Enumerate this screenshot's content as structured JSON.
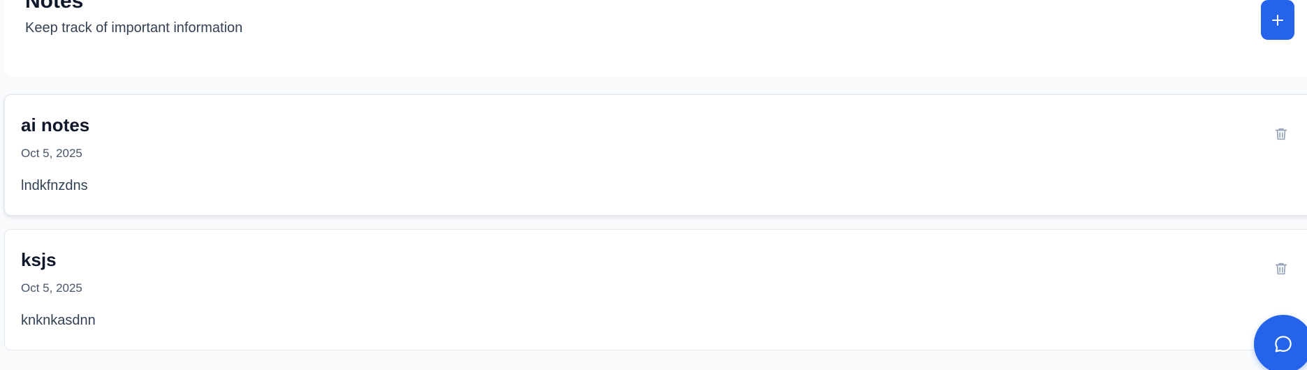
{
  "header": {
    "title": "Notes",
    "subtitle": "Keep track of important information",
    "add_icon": "plus-icon",
    "accent_color": "#2563eb"
  },
  "notes": [
    {
      "title": "ai notes",
      "date": "Oct 5, 2025",
      "content": "lndkfnzdns",
      "delete_icon": "trash-icon"
    },
    {
      "title": "ksjs",
      "date": "Oct 5, 2025",
      "content": "knknkasdnn",
      "delete_icon": "trash-icon"
    }
  ],
  "chat": {
    "icon": "chat-bubble-icon"
  }
}
